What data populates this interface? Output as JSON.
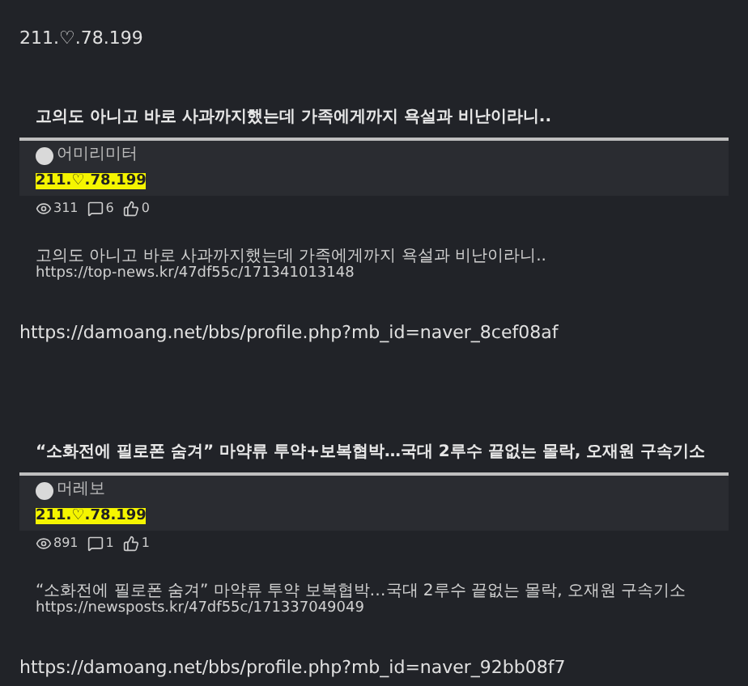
{
  "header_text": "211.♡.78.199",
  "posts": [
    {
      "title": "고의도 아니고 바로 사과까지했는데 가족에게까지 욕설과 비난이라니..",
      "author": "어미리미터",
      "ip": "211.♡.78.199",
      "views": "311",
      "comments": "6",
      "likes": "0",
      "body": "고의도 아니고 바로 사과까지했는데 가족에게까지 욕설과 비난이라니..",
      "link": "https://top-news.kr/47df55c/171341013148",
      "profile_url": "https://damoang.net/bbs/profile.php?mb_id=naver_8cef08af"
    },
    {
      "title": "“소화전에 필로폰 숨겨” 마약류 투약+보복협박…국대 2루수 끝없는 몰락, 오재원 구속기소",
      "author": "머레보",
      "ip": "211.♡.78.199",
      "views": "891",
      "comments": "1",
      "likes": "1",
      "body": "“소화전에 필로폰 숨겨” 마약류 투약 보복협박…국대 2루수 끝없는 몰락, 오재원 구속기소",
      "link": "https://newsposts.kr/47df55c/171337049049",
      "profile_url": "https://damoang.net/bbs/profile.php?mb_id=naver_92bb08f7"
    }
  ]
}
